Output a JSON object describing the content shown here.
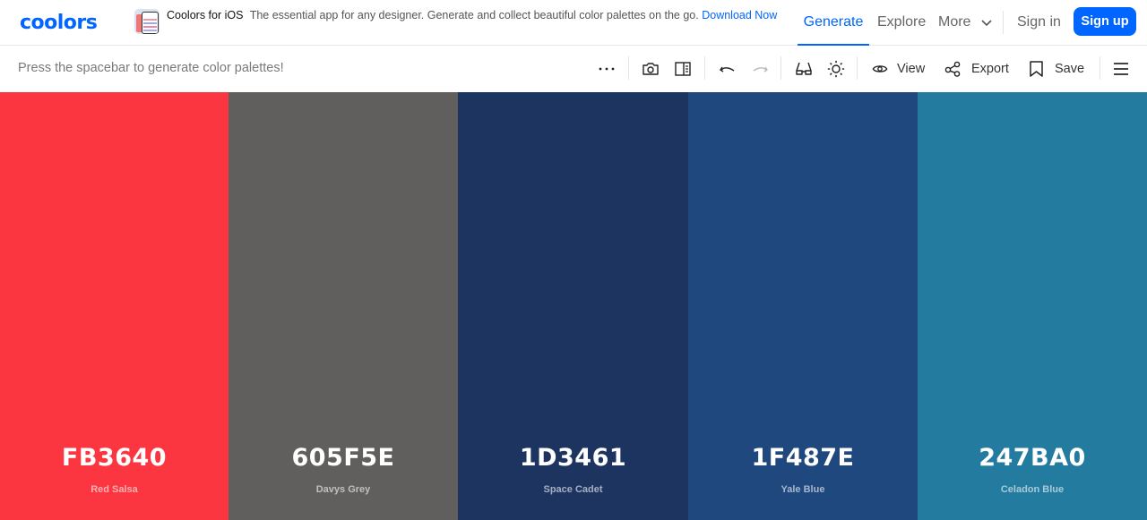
{
  "header": {
    "logo": "coolors",
    "promo": {
      "title": "Coolors for iOS",
      "description": "The essential app for any designer. Generate and collect beautiful color palettes on the go.",
      "link": "Download Now"
    },
    "nav": [
      {
        "label": "Generate",
        "active": true
      },
      {
        "label": "Explore",
        "active": false
      },
      {
        "label": "More",
        "active": false
      }
    ],
    "sign_in": "Sign in",
    "sign_up": "Sign up"
  },
  "toolbar": {
    "hint": "Press the spacebar to generate color palettes!",
    "icons": [
      "more-icon",
      "camera-icon",
      "sidebar-panel-icon",
      "undo-icon",
      "redo-icon",
      "glasses-icon",
      "brightness-icon"
    ],
    "view_label": "View",
    "export_label": "Export",
    "save_label": "Save"
  },
  "palette": [
    {
      "hex": "FB3640",
      "name": "Red Salsa",
      "color": "#FB3640"
    },
    {
      "hex": "605F5E",
      "name": "Davys Grey",
      "color": "#605F5E"
    },
    {
      "hex": "1D3461",
      "name": "Space Cadet",
      "color": "#1D3461"
    },
    {
      "hex": "1F487E",
      "name": "Yale Blue",
      "color": "#1F487E"
    },
    {
      "hex": "247BA0",
      "name": "Celadon Blue",
      "color": "#247BA0"
    }
  ],
  "colors": {
    "accent": "#0066ff"
  }
}
